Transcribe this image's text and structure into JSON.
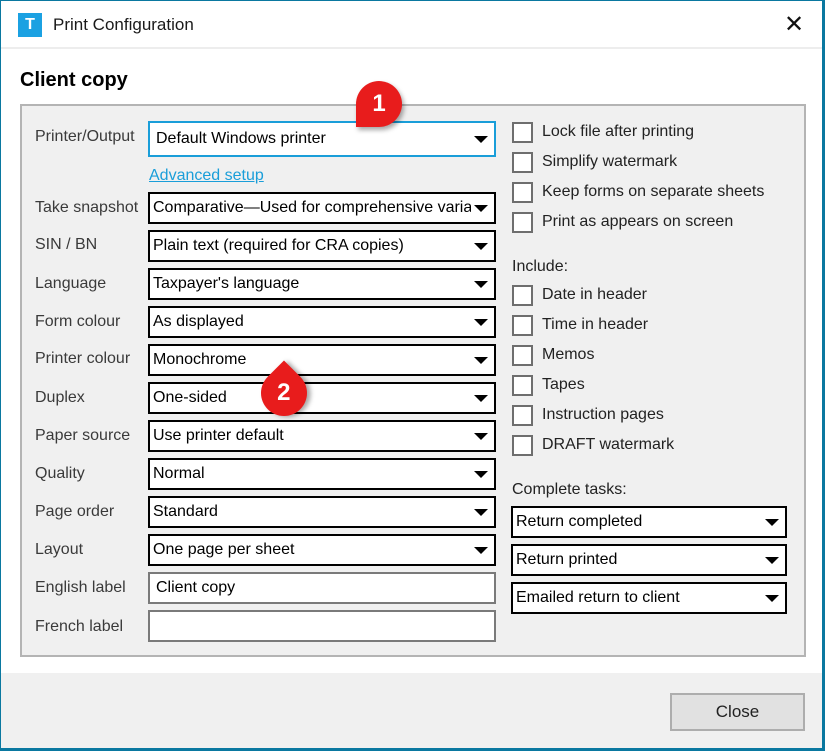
{
  "window": {
    "title": "Print Configuration",
    "app_icon_glyph": "T",
    "close_glyph": "✕"
  },
  "heading": "Client copy",
  "form": {
    "printer_output": {
      "label": "Printer/Output",
      "value": "Default Windows printer"
    },
    "advanced_setup_link": "Advanced setup",
    "take_snapshot": {
      "label": "Take snapshot",
      "value": "Comparative—Used for comprehensive variance"
    },
    "sin_bn": {
      "label": "SIN / BN",
      "value": "Plain text (required for CRA copies)"
    },
    "language": {
      "label": "Language",
      "value": "Taxpayer's language"
    },
    "form_colour": {
      "label": "Form colour",
      "value": "As displayed"
    },
    "printer_colour": {
      "label": "Printer colour",
      "value": "Monochrome"
    },
    "duplex": {
      "label": "Duplex",
      "value": "One-sided"
    },
    "paper_source": {
      "label": "Paper source",
      "value": "Use printer default"
    },
    "quality": {
      "label": "Quality",
      "value": "Normal"
    },
    "page_order": {
      "label": "Page order",
      "value": "Standard"
    },
    "layout": {
      "label": "Layout",
      "value": "One page per sheet"
    },
    "english_label": {
      "label": "English label",
      "value": "Client copy"
    },
    "french_label": {
      "label": "French label",
      "value": ""
    }
  },
  "options": [
    {
      "label": "Lock file after printing",
      "checked": false
    },
    {
      "label": "Simplify watermark",
      "checked": false
    },
    {
      "label": "Keep forms on separate sheets",
      "checked": false
    },
    {
      "label": "Print as appears on screen",
      "checked": false
    }
  ],
  "include": {
    "label": "Include:",
    "items": [
      {
        "label": "Date in header",
        "checked": false
      },
      {
        "label": "Time in header",
        "checked": false
      },
      {
        "label": "Memos",
        "checked": false
      },
      {
        "label": "Tapes",
        "checked": false
      },
      {
        "label": "Instruction pages",
        "checked": false
      },
      {
        "label": "DRAFT watermark",
        "checked": false
      }
    ]
  },
  "complete_tasks": {
    "label": "Complete tasks:",
    "items": [
      "Return completed",
      "Return printed",
      "Emailed return to client"
    ]
  },
  "footer": {
    "close_label": "Close"
  },
  "annotations": {
    "badge1": "1",
    "badge2": "2"
  }
}
